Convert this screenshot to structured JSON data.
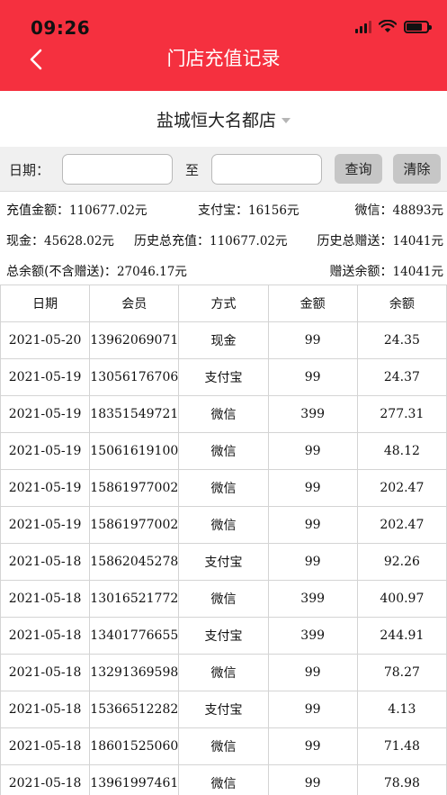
{
  "status_bar": {
    "time": "09:26"
  },
  "header": {
    "title": "门店充值记录",
    "back_icon": "chevron-left-icon"
  },
  "store": {
    "name": "盐城恒大名都店"
  },
  "filter": {
    "date_label": "日期：",
    "to_label": "至",
    "start_date_value": "",
    "end_date_value": "",
    "query_label": "查询",
    "clear_label": "清除"
  },
  "summary": {
    "recharge_total_label": "充值金额：",
    "recharge_total_value": "110677.02元",
    "alipay_label": "支付宝：",
    "alipay_value": "16156元",
    "wechat_label": "微信：",
    "wechat_value": "48893元",
    "cash_label": "现金：",
    "cash_value": "45628.02元",
    "history_recharge_label": "历史总充值：",
    "history_recharge_value": "110677.02元",
    "history_gift_label": "历史总赠送：",
    "history_gift_value": "14041元",
    "total_balance_label": "总余额(不含赠送)：",
    "total_balance_value": "27046.17元",
    "gift_balance_label": "赠送余额：",
    "gift_balance_value": "14041元"
  },
  "table": {
    "columns": [
      "日期",
      "会员",
      "方式",
      "金额",
      "余额"
    ],
    "rows": [
      [
        "2021-05-20",
        "13962069071",
        "现金",
        "99",
        "24.35"
      ],
      [
        "2021-05-19",
        "13056176706",
        "支付宝",
        "99",
        "24.37"
      ],
      [
        "2021-05-19",
        "18351549721",
        "微信",
        "399",
        "277.31"
      ],
      [
        "2021-05-19",
        "15061619100",
        "微信",
        "99",
        "48.12"
      ],
      [
        "2021-05-19",
        "15861977002",
        "微信",
        "99",
        "202.47"
      ],
      [
        "2021-05-19",
        "15861977002",
        "微信",
        "99",
        "202.47"
      ],
      [
        "2021-05-18",
        "15862045278",
        "支付宝",
        "99",
        "92.26"
      ],
      [
        "2021-05-18",
        "13016521772",
        "微信",
        "399",
        "400.97"
      ],
      [
        "2021-05-18",
        "13401776655",
        "支付宝",
        "399",
        "244.91"
      ],
      [
        "2021-05-18",
        "13291369598",
        "微信",
        "99",
        "78.27"
      ],
      [
        "2021-05-18",
        "15366512282",
        "支付宝",
        "99",
        "4.13"
      ],
      [
        "2021-05-18",
        "18601525060",
        "微信",
        "99",
        "71.48"
      ],
      [
        "2021-05-18",
        "13961997461",
        "微信",
        "99",
        "78.98"
      ]
    ]
  }
}
